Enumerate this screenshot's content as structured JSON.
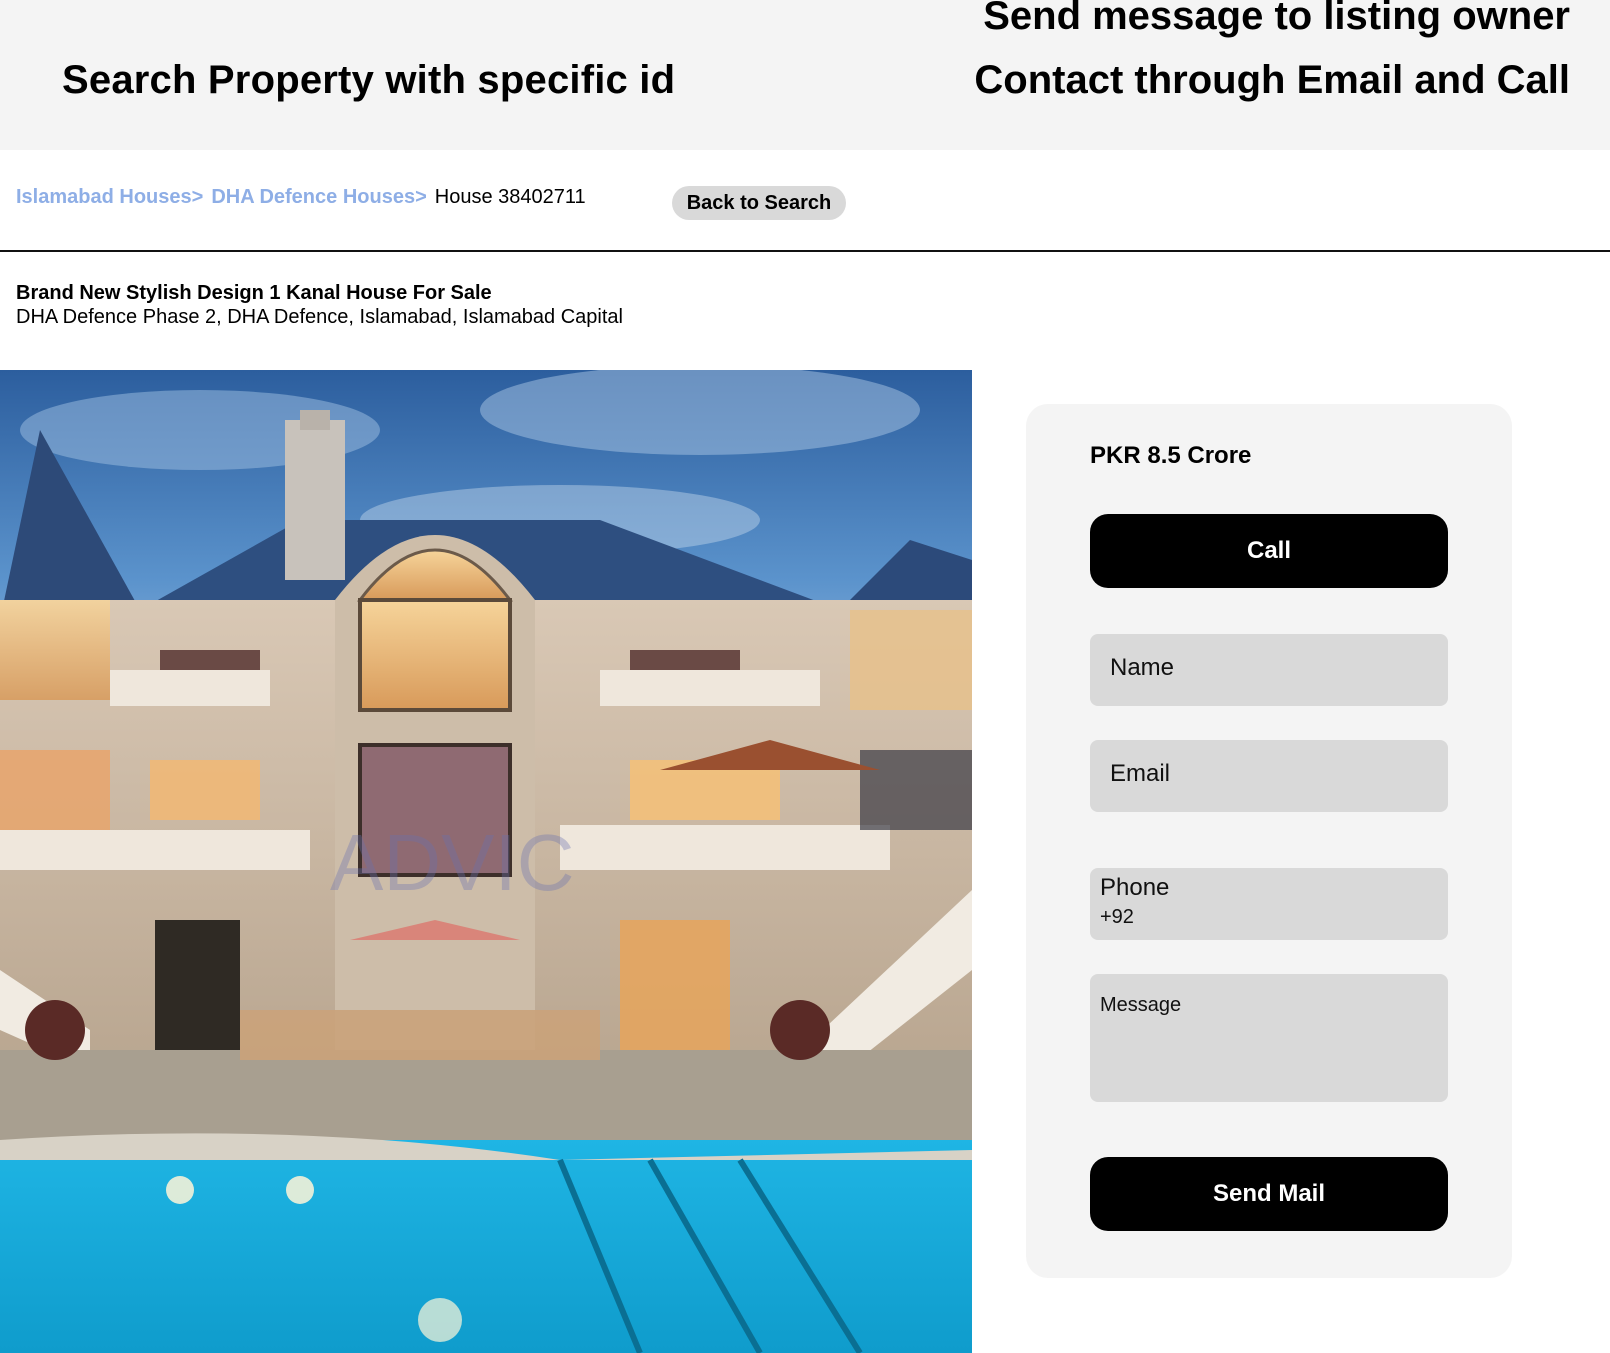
{
  "banner": {
    "left_text": "Search Property with specific id",
    "right_line1": "Send message to listing owner",
    "right_line2": "Contact through Email and Call"
  },
  "breadcrumb": {
    "items": [
      "Islamabad Houses>",
      "DHA Defence Houses>"
    ],
    "current": "House 38402711"
  },
  "back_button": "Back to Search",
  "listing": {
    "title": "Brand New Stylish Design 1 Kanal House For Sale",
    "address": "DHA Defence Phase 2, DHA Defence, Islamabad, Islamabad Capital",
    "photo_watermark": "ADVIC"
  },
  "contact": {
    "price": "PKR 8.5 Crore",
    "call_label": "Call",
    "name_placeholder": "Name",
    "email_placeholder": "Email",
    "phone_label": "Phone",
    "phone_prefix": "+92",
    "message_placeholder": "Message",
    "send_label": "Send Mail"
  },
  "colors": {
    "banner_bg": "#f4f4f4",
    "breadcrumb_link": "#8eaee6",
    "button_black": "#000000",
    "field_bg": "#d9d9d9",
    "panel_bg": "#f4f4f4"
  }
}
